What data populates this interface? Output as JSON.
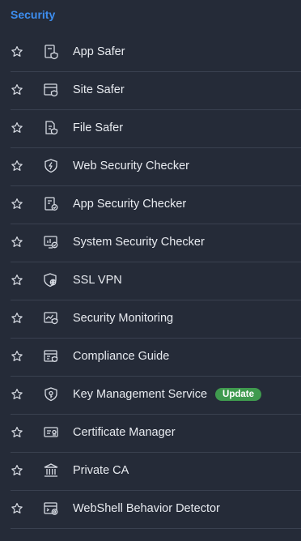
{
  "section": {
    "title": "Security"
  },
  "items": [
    {
      "label": "App Safer",
      "icon": "app-safer-icon"
    },
    {
      "label": "Site Safer",
      "icon": "site-safer-icon"
    },
    {
      "label": "File Safer",
      "icon": "file-safer-icon"
    },
    {
      "label": "Web Security Checker",
      "icon": "web-security-checker-icon"
    },
    {
      "label": "App Security Checker",
      "icon": "app-security-checker-icon"
    },
    {
      "label": "System Security Checker",
      "icon": "system-security-checker-icon"
    },
    {
      "label": "SSL VPN",
      "icon": "ssl-vpn-icon"
    },
    {
      "label": "Security Monitoring",
      "icon": "security-monitoring-icon"
    },
    {
      "label": "Compliance Guide",
      "icon": "compliance-guide-icon"
    },
    {
      "label": "Key Management Service",
      "icon": "key-management-icon",
      "badge": "Update"
    },
    {
      "label": "Certificate Manager",
      "icon": "certificate-manager-icon"
    },
    {
      "label": "Private CA",
      "icon": "private-ca-icon"
    },
    {
      "label": "WebShell Behavior Detector",
      "icon": "webshell-detector-icon"
    }
  ],
  "colors": {
    "background": "#252b38",
    "accent": "#3d8ef0",
    "badge": "#3f9a4e",
    "divider": "#3a4150"
  }
}
